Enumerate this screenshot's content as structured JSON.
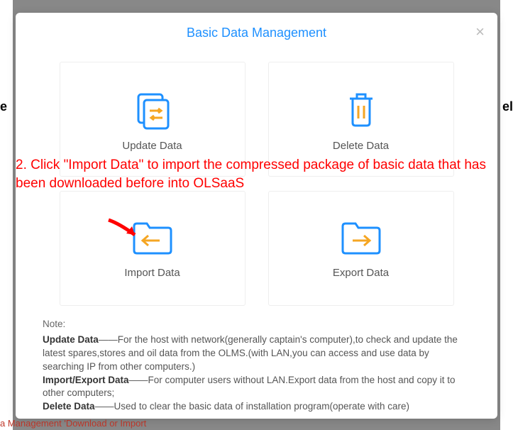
{
  "bg": {
    "left_letter": "e",
    "right_letter": "el",
    "bottom_text": "a Management 'Download or Import"
  },
  "modal": {
    "title": "Basic Data Management"
  },
  "tiles": {
    "update": "Update Data",
    "delete": "Delete Data",
    "import": "Import Data",
    "export": "Export Data"
  },
  "annotation": "2. Click \"Import Data\" to import the compressed package of basic data that has been downloaded before into OLSaaS",
  "notes": {
    "header": "Note:",
    "update_label": "Update Data",
    "update_text": "——For the host with network(generally captain's computer),to check and update the latest spares,stores and oil data from the OLMS.(with LAN,you can access and use data by searching IP from other computers.)",
    "ie_label": "Import/Export Data",
    "ie_text": "——For computer users without LAN.Export data from the host and copy it to other computers;",
    "delete_label": "Delete Data",
    "delete_text": "——Used to clear the basic data of installation program(operate with care)"
  }
}
